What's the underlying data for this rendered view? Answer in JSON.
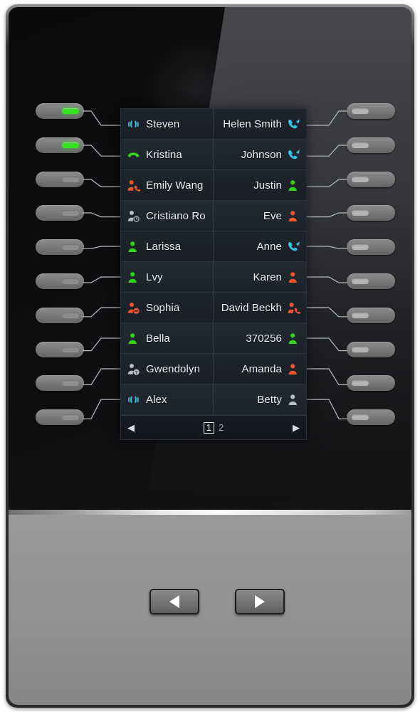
{
  "device": {
    "name": "phone-expansion-module",
    "colors": {
      "led_green": "#37e024",
      "led_off": "#8e8e8e",
      "screen_bg": "#1b2026",
      "icon_cyan": "#31c3ea",
      "icon_green": "#2fd61a",
      "icon_orange": "#f0562c",
      "icon_gray": "#b6bcc2",
      "text": "#eef1f3"
    }
  },
  "screen": {
    "rows": [
      {
        "left": {
          "label": "Steven",
          "icon": "intercom-icon",
          "icon_color": "cyan"
        },
        "right": {
          "label": "Helen Smith",
          "icon": "handset-incoming-icon",
          "icon_color": "cyan"
        }
      },
      {
        "left": {
          "label": "Kristina",
          "icon": "handset-pickup-icon",
          "icon_color": "green"
        },
        "right": {
          "label": "Johnson",
          "icon": "handset-incoming-icon",
          "icon_color": "cyan"
        }
      },
      {
        "left": {
          "label": "Emily Wang",
          "icon": "person-oncall-icon",
          "icon_color": "orange"
        },
        "right": {
          "label": "Justin",
          "icon": "person-icon",
          "icon_color": "green"
        }
      },
      {
        "left": {
          "label": "Cristiano Ro",
          "icon": "person-clock-icon",
          "icon_color": "gray"
        },
        "right": {
          "label": "Eve",
          "icon": "person-icon",
          "icon_color": "orange"
        }
      },
      {
        "left": {
          "label": "Larissa",
          "icon": "person-icon",
          "icon_color": "green"
        },
        "right": {
          "label": "Anne",
          "icon": "handset-incoming-icon",
          "icon_color": "cyan"
        }
      },
      {
        "left": {
          "label": "Lvy",
          "icon": "person-icon",
          "icon_color": "green"
        },
        "right": {
          "label": "Karen",
          "icon": "person-icon",
          "icon_color": "orange"
        }
      },
      {
        "left": {
          "label": "Sophia",
          "icon": "person-dnd-icon",
          "icon_color": "orange"
        },
        "right": {
          "label": "David Beckh",
          "icon": "person-oncall-icon",
          "icon_color": "orange"
        }
      },
      {
        "left": {
          "label": "Bella",
          "icon": "person-icon",
          "icon_color": "green"
        },
        "right": {
          "label": "370256",
          "icon": "person-icon",
          "icon_color": "green"
        }
      },
      {
        "left": {
          "label": "Gwendolyn",
          "icon": "person-unknown-icon",
          "icon_color": "gray"
        },
        "right": {
          "label": "Amanda",
          "icon": "person-icon",
          "icon_color": "orange"
        }
      },
      {
        "left": {
          "label": "Alex",
          "icon": "intercom-icon",
          "icon_color": "cyan"
        },
        "right": {
          "label": "Betty",
          "icon": "person-icon",
          "icon_color": "gray"
        }
      }
    ],
    "pager": {
      "prev_glyph": "◀",
      "next_glyph": "▶",
      "pages": [
        {
          "label": "1",
          "selected": true
        },
        {
          "label": "2",
          "selected": false
        }
      ]
    }
  },
  "left_keys": [
    {
      "led": "green"
    },
    {
      "led": "green"
    },
    {
      "led": "off"
    },
    {
      "led": "off"
    },
    {
      "led": "off"
    },
    {
      "led": "off"
    },
    {
      "led": "off"
    },
    {
      "led": "off"
    },
    {
      "led": "off"
    },
    {
      "led": "off"
    }
  ],
  "right_keys": [
    {
      "led": "off-light"
    },
    {
      "led": "off-light"
    },
    {
      "led": "off-light"
    },
    {
      "led": "off-light"
    },
    {
      "led": "off-light"
    },
    {
      "led": "off-light"
    },
    {
      "led": "off-light"
    },
    {
      "led": "off-light"
    },
    {
      "led": "off-light"
    },
    {
      "led": "off-light"
    }
  ],
  "nav": {
    "prev": {
      "name": "page-prev-button",
      "glyph": "◀"
    },
    "next": {
      "name": "page-next-button",
      "glyph": "▶"
    }
  }
}
